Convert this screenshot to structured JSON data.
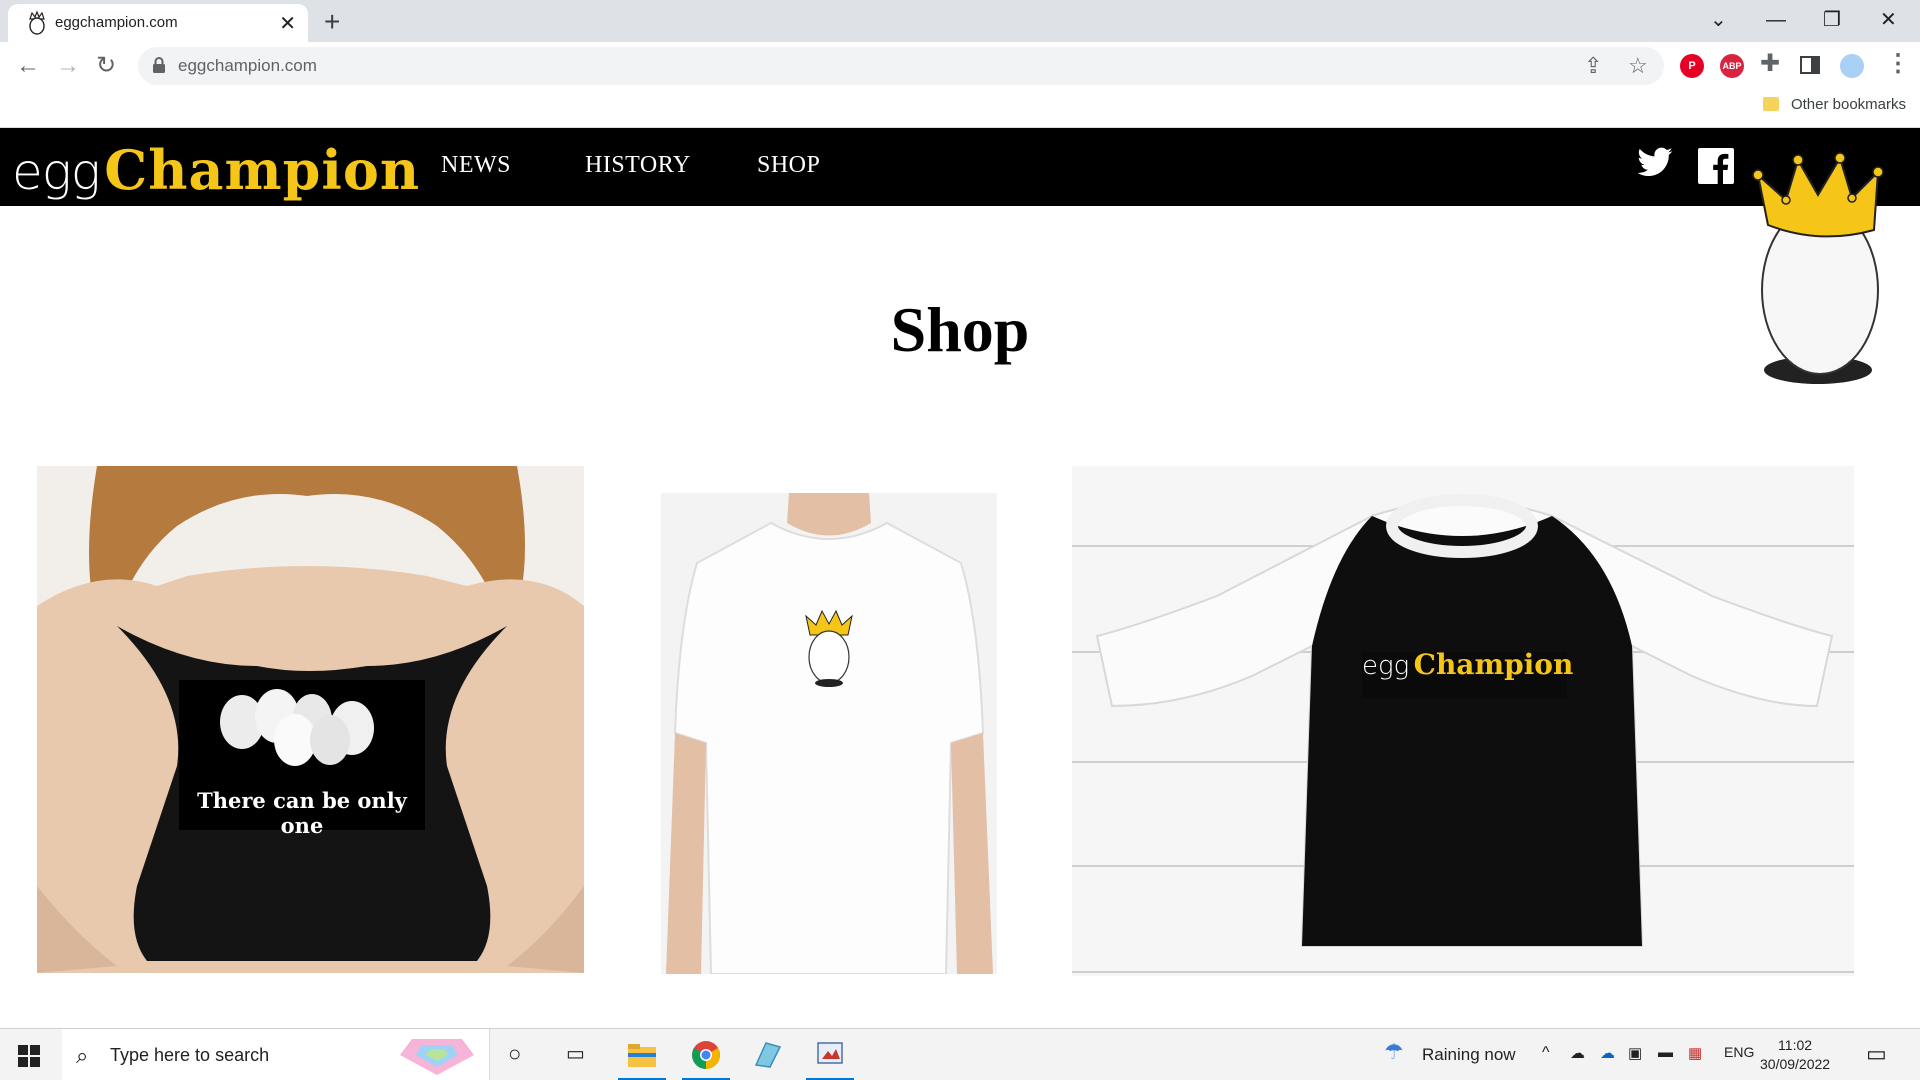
{
  "browser": {
    "tab_title": "eggchampion.com",
    "tab_close": "✕",
    "new_tab": "+",
    "url": "eggchampion.com",
    "bookmarks_label": "Other bookmarks",
    "window_min": "—",
    "window_max": "❐",
    "window_close": "✕",
    "tab_search": "⌄"
  },
  "site": {
    "logo_egg": "egg",
    "logo_champion": "Champion",
    "nav": [
      "NEWS",
      "HISTORY",
      "SHOP"
    ],
    "page_title": "Shop",
    "product1_tagline": "There can be only one",
    "product3_logo_egg": "egg",
    "product3_logo_champion": "Champion"
  },
  "taskbar": {
    "search_placeholder": "Type here to search",
    "weather": "Raining now",
    "language": "ENG",
    "time": "11:02",
    "date": "30/09/2022"
  },
  "colors": {
    "brand_gold": "#f5c518",
    "nav_bg": "#000000",
    "chrome_tabstrip": "#dee1e6"
  }
}
